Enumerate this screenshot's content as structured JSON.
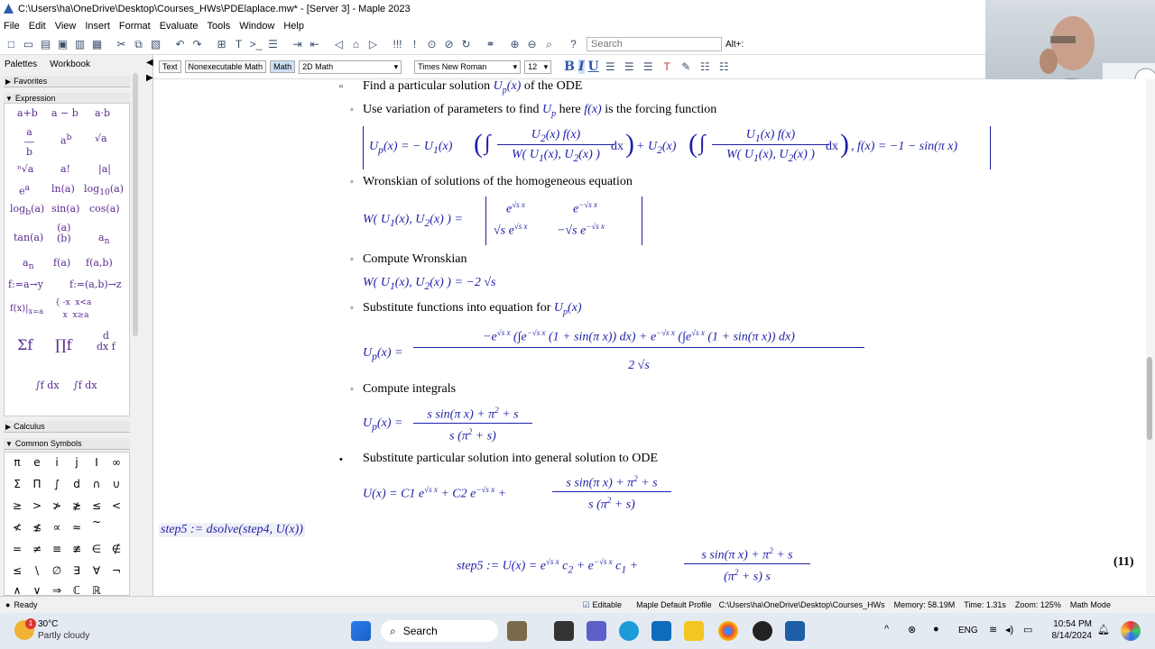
{
  "window": {
    "title": "C:\\Users\\ha\\OneDrive\\Desktop\\Courses_HWs\\PDElaplace.mw* - [Server 3] - Maple 2023"
  },
  "menu": [
    "File",
    "Edit",
    "View",
    "Insert",
    "Format",
    "Evaluate",
    "Tools",
    "Window",
    "Help"
  ],
  "toolbar": {
    "search_placeholder": "Search",
    "search_shortcut": "Alt+:"
  },
  "sidebar": {
    "tabs": [
      "Palettes",
      "Workbook"
    ],
    "sections": {
      "favorites": "Favorites",
      "expression": "Expression",
      "calculus": "Calculus",
      "common": "Common Symbols"
    },
    "symbols": [
      "π",
      "e",
      "i",
      "j",
      "I",
      "∞",
      "Σ",
      "Π",
      "∫",
      "d",
      "∩",
      "∪",
      "≥",
      ">",
      "≯",
      "≵",
      "≤",
      "<",
      "≮",
      "≴",
      "∝",
      "≈",
      "~",
      "",
      "=",
      "≠",
      "≡",
      "≢",
      "∈",
      "∉",
      "≤",
      "\\",
      "∅",
      "∃",
      "∀",
      "¬",
      "∧",
      "∨",
      "⇒",
      "ℂ",
      "ℝ",
      ""
    ]
  },
  "format": {
    "text": "Text",
    "nonexec": "Nonexecutable Math",
    "math": "Math",
    "mode": "2D Math",
    "font": "Times New Roman",
    "size": "12",
    "bold": "B",
    "italic": "I",
    "underline": "U"
  },
  "doc": {
    "l1": "Find a particular solution ",
    "l1m": "U",
    "l1s": "p",
    "l1m2": "(x)",
    "l1t": " of the ODE",
    "l2": "Use variation of parameters to find ",
    "l2m": "U",
    "l2s": "p",
    "l2t": " here ",
    "l2m2": "f(x)",
    "l2t2": " is the forcing function",
    "l3": "Wronskian of solutions of the homogeneous equation",
    "l4": "Compute Wronskian",
    "l5": "Substitute functions into equation for ",
    "l5m": "U",
    "l5s": "p",
    "l5m2": "(x)",
    "l6": "Compute integrals",
    "l7": "Substitute particular solution into general solution to ODE",
    "cmd": "step5 := dsolve(step4, U(x))",
    "eqlabel": "(11)"
  },
  "status": {
    "ready": "Ready",
    "editable": "Editable",
    "profile": "Maple Default Profile",
    "path": "C:\\Users\\ha\\OneDrive\\Desktop\\Courses_HWs",
    "memory": "Memory: 58.19M",
    "time": "Time: 1.31s",
    "zoom": "Zoom: 125%",
    "mode": "Math Mode"
  },
  "taskbar": {
    "temp": "30°C",
    "weather": "Partly cloudy",
    "badge": "1",
    "search": "Search",
    "lang": "ENG",
    "time": "10:54 PM",
    "date": "8/14/2024"
  }
}
